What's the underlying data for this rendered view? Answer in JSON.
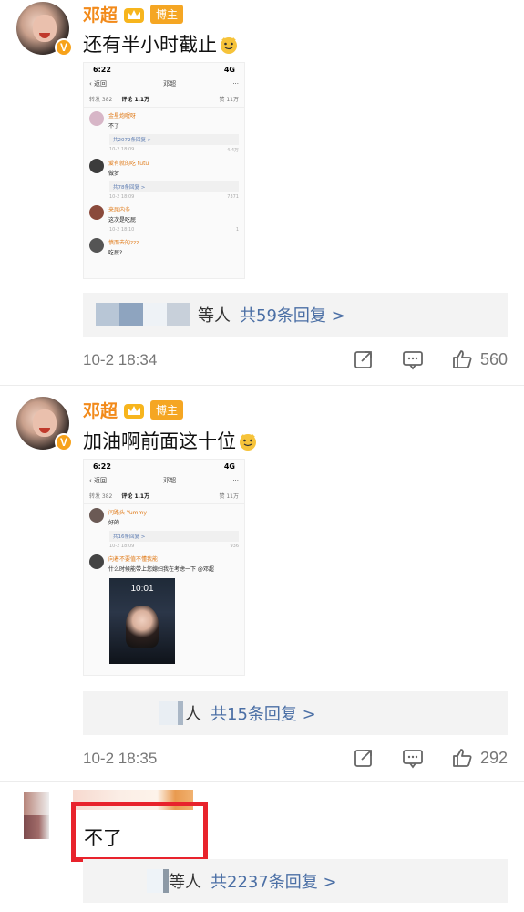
{
  "posts": [
    {
      "username": "邓超",
      "badge": "博主",
      "content": "还有半小时截止",
      "screenshot": {
        "status_time": "6:22",
        "status_right": "4G",
        "back": "返回",
        "nav_name": "邓超",
        "tab_repost": "转发 382",
        "tab_comments": "评论 1.1万",
        "tab_likes": "赞 11万",
        "comments": [
          {
            "name": "金星炮喔呀",
            "text": "不了",
            "reply": "共2072条回复 >",
            "time": "10-2 18:09",
            "likes": "4.4万"
          },
          {
            "name": "爱有就的吃 tutu",
            "text": "做梦",
            "reply": "共78条回复 >",
            "time": "10-2 18:09",
            "likes": "7371"
          },
          {
            "name": "来屈内多",
            "text": "这次是吃屁",
            "reply": "",
            "time": "10-2 18:10",
            "likes": "1"
          },
          {
            "name": "慎而去的zzz",
            "text": "吃屁?",
            "reply": "",
            "time": "",
            "likes": ""
          }
        ]
      },
      "reply_text": "等人",
      "reply_count": "共59条回复 >",
      "time": "10-2 18:34",
      "likes": "560"
    },
    {
      "username": "邓超",
      "badge": "博主",
      "content": "加油啊前面这十位",
      "screenshot": {
        "status_time": "6:22",
        "status_right": "4G",
        "back": "返回",
        "nav_name": "邓超",
        "tab_repost": "转发 382",
        "tab_comments": "评论 1.1万",
        "tab_likes": "赞 11万",
        "comments": [
          {
            "name": "问路头 Yummy",
            "text": "好的",
            "reply": "共16条回复 >",
            "time": "10-2 18:09",
            "likes": "936"
          },
          {
            "name": "向着不要值不懂我能",
            "text": "什么时候能带上您媳妇我在考虑一下 @邓超",
            "reply": "",
            "time": "",
            "likes": ""
          }
        ],
        "lock_time": "10:01"
      },
      "reply_text": "人",
      "reply_count": "共15条回复 >",
      "time": "10-2 18:35",
      "likes": "292"
    },
    {
      "content": "不了",
      "reply_text": "等人",
      "reply_count": "共2237条回复 >"
    }
  ],
  "colors": {
    "username": "#f28a1a",
    "badge": "#f5a623",
    "link": "#4b6fa5",
    "highlight": "#e8232c"
  },
  "icons": [
    "crown-icon",
    "verified-icon",
    "share-icon",
    "comment-icon",
    "like-icon",
    "chevron-right-icon",
    "emoji-icon"
  ]
}
